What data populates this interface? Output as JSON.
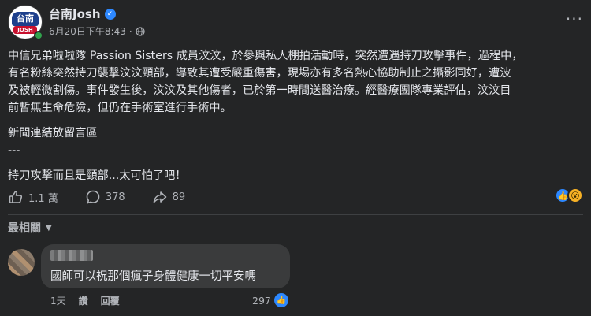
{
  "post": {
    "author": "台南Josh",
    "avatar_text_top": "台南",
    "avatar_text_bottom": "JOSH",
    "timestamp": "6月20日下午8:43",
    "dot": "·",
    "body_lines": [
      "中信兄弟啦啦隊 Passion Sisters 成員汶汶，於參與私人棚拍活動時，突然遭遇持刀攻擊事件，過程中，",
      "有名粉絲突然持刀襲擊汶汶頸部，導致其遭受嚴重傷害，現場亦有多名熱心協助制止之攝影同好，遭波",
      "及被輕微割傷。事件發生後，汶汶及其他傷者，已於第一時間送醫治療。經醫療團隊專業評估，汶汶目",
      "前暫無生命危險，但仍在手術室進行手術中。"
    ],
    "news_note": "新聞連結放留言區",
    "separator": "---",
    "comment_line": "持刀攻擊而且是頸部...太可怕了吧！"
  },
  "stats": {
    "likes": "1.1 萬",
    "comments": "378",
    "shares": "89"
  },
  "comments_section": {
    "sort_label": "最相關",
    "comment": {
      "text": "國師可以祝那個瘋子身體健康一切平安嗎",
      "time": "1天",
      "like_label": "讚",
      "reply_label": "回覆",
      "like_count": "297"
    }
  },
  "colors": {
    "background": "#242526",
    "accent": "#2d88ff",
    "online": "#31a24c"
  },
  "icons": [
    "verified-icon",
    "globe-icon",
    "more-icon",
    "like-outline-icon",
    "comment-icon",
    "share-icon",
    "like-reaction-icon",
    "wow-reaction-icon",
    "chevron-down-icon"
  ]
}
